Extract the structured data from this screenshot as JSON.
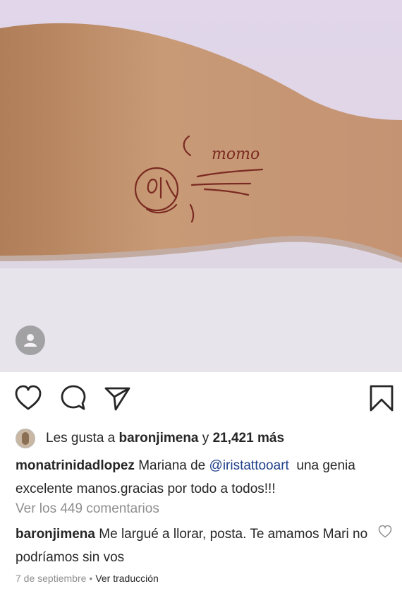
{
  "post": {
    "tattoo_text": "momo",
    "likes": {
      "prefix": "Les gusta a",
      "user": "baronjimena",
      "connector": "y",
      "count": "21,421",
      "suffix": "más"
    },
    "caption": {
      "user": "monatrinidadlopez",
      "text_before": "Mariana de",
      "mention": "@iristattooart",
      "text_after": "una genia excelente manos.gracias por todo a todos!!!"
    },
    "view_comments": "Ver los 449 comentarios",
    "comment": {
      "user": "baronjimena",
      "text": "Me largué a llorar, posta. Te amamos Mari no podríamos sin vos"
    },
    "date": "7 de septiembre",
    "separator": "•",
    "translate": "Ver traducción"
  },
  "icons": {
    "like": "heart-icon",
    "comment": "comment-icon",
    "share": "send-icon",
    "save": "bookmark-icon",
    "tag": "user-tag-icon",
    "comment_like": "heart-icon"
  }
}
